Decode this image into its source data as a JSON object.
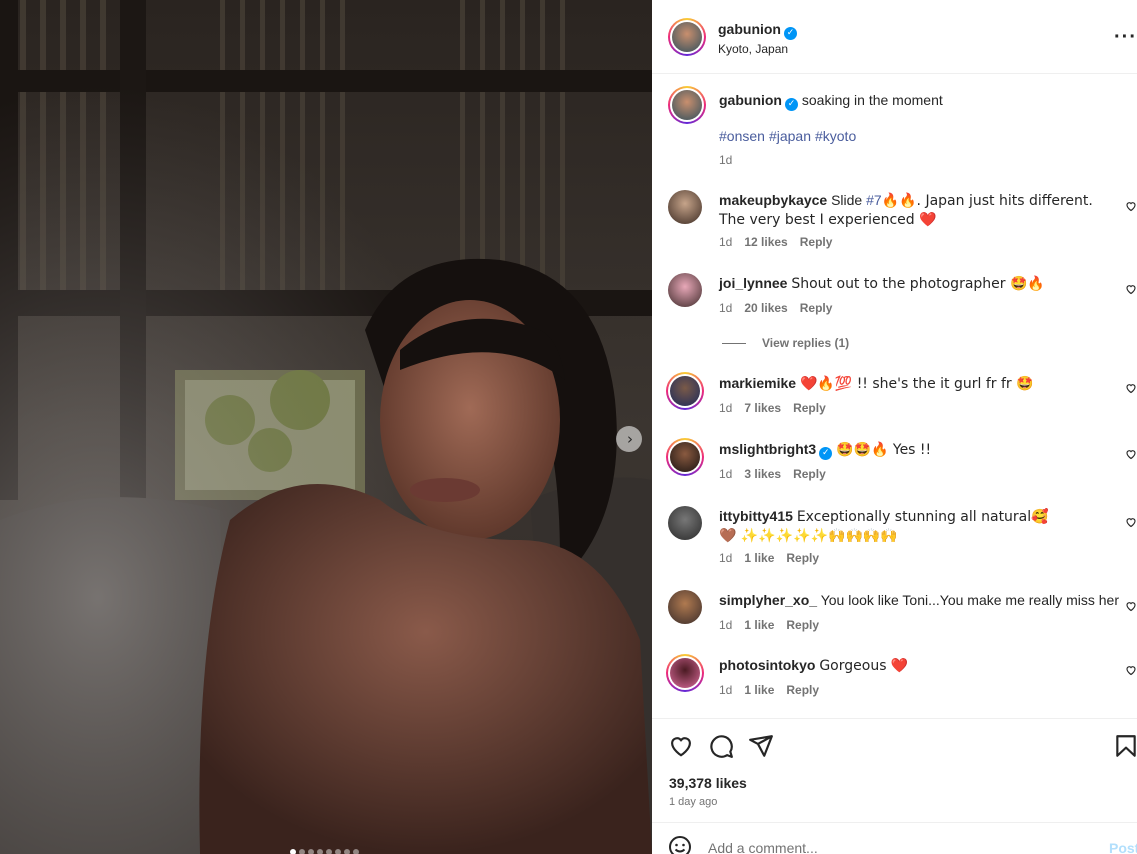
{
  "post": {
    "author": "gabunion",
    "location": "Kyoto, Japan",
    "caption": "soaking in the moment",
    "hashtags": [
      "#onsen",
      "#japan",
      "#kyoto"
    ],
    "caption_time": "1d",
    "likes": "39,378 likes",
    "time_ago": "1 day ago"
  },
  "comments": [
    {
      "user": "makeupbykayce",
      "text_before": "Slide ",
      "tag": "#7",
      "text_after": "🔥🔥. Japan just hits different. The very best I experienced ❤️",
      "time": "1d",
      "likes": "12 likes",
      "reply": "Reply"
    },
    {
      "user": "joi_lynnee",
      "text": "Shout out to the photographer 🤩🔥",
      "time": "1d",
      "likes": "20 likes",
      "reply": "Reply"
    },
    {
      "user": "markiemike",
      "text": "❤️🔥💯 !! she's the it gurl fr fr 🤩",
      "time": "1d",
      "likes": "7 likes",
      "reply": "Reply"
    },
    {
      "user": "mslightbright3",
      "text": "🤩🤩🔥 Yes !!",
      "time": "1d",
      "likes": "3 likes",
      "reply": "Reply"
    },
    {
      "user": "ittybitty415",
      "text": "Exceptionally stunning all natural🥰🤎 ✨✨✨✨✨🙌🙌🙌🙌",
      "time": "1d",
      "likes": "1 like",
      "reply": "Reply"
    },
    {
      "user": "simplyher_xo_",
      "text": "You look like Toni...You make me really miss her",
      "time": "1d",
      "likes": "1 like",
      "reply": "Reply"
    },
    {
      "user": "photosintokyo",
      "text": "Gorgeous ❤️",
      "time": "1d",
      "likes": "1 like",
      "reply": "Reply"
    }
  ],
  "view_replies": "View replies (1)",
  "add_comment": {
    "placeholder": "Add a comment...",
    "post_label": "Post"
  },
  "icons": {
    "more": "more-options-icon",
    "next": "chevron-right-icon",
    "like": "heart-icon",
    "comment": "comment-icon",
    "share": "send-icon",
    "save": "bookmark-icon",
    "emoji": "emoji-icon"
  },
  "colors": {
    "verified": "#0095f6",
    "hashtag": "#4a5d9d",
    "heart_red": "#ed4956",
    "post_button": "#b2dffc"
  }
}
